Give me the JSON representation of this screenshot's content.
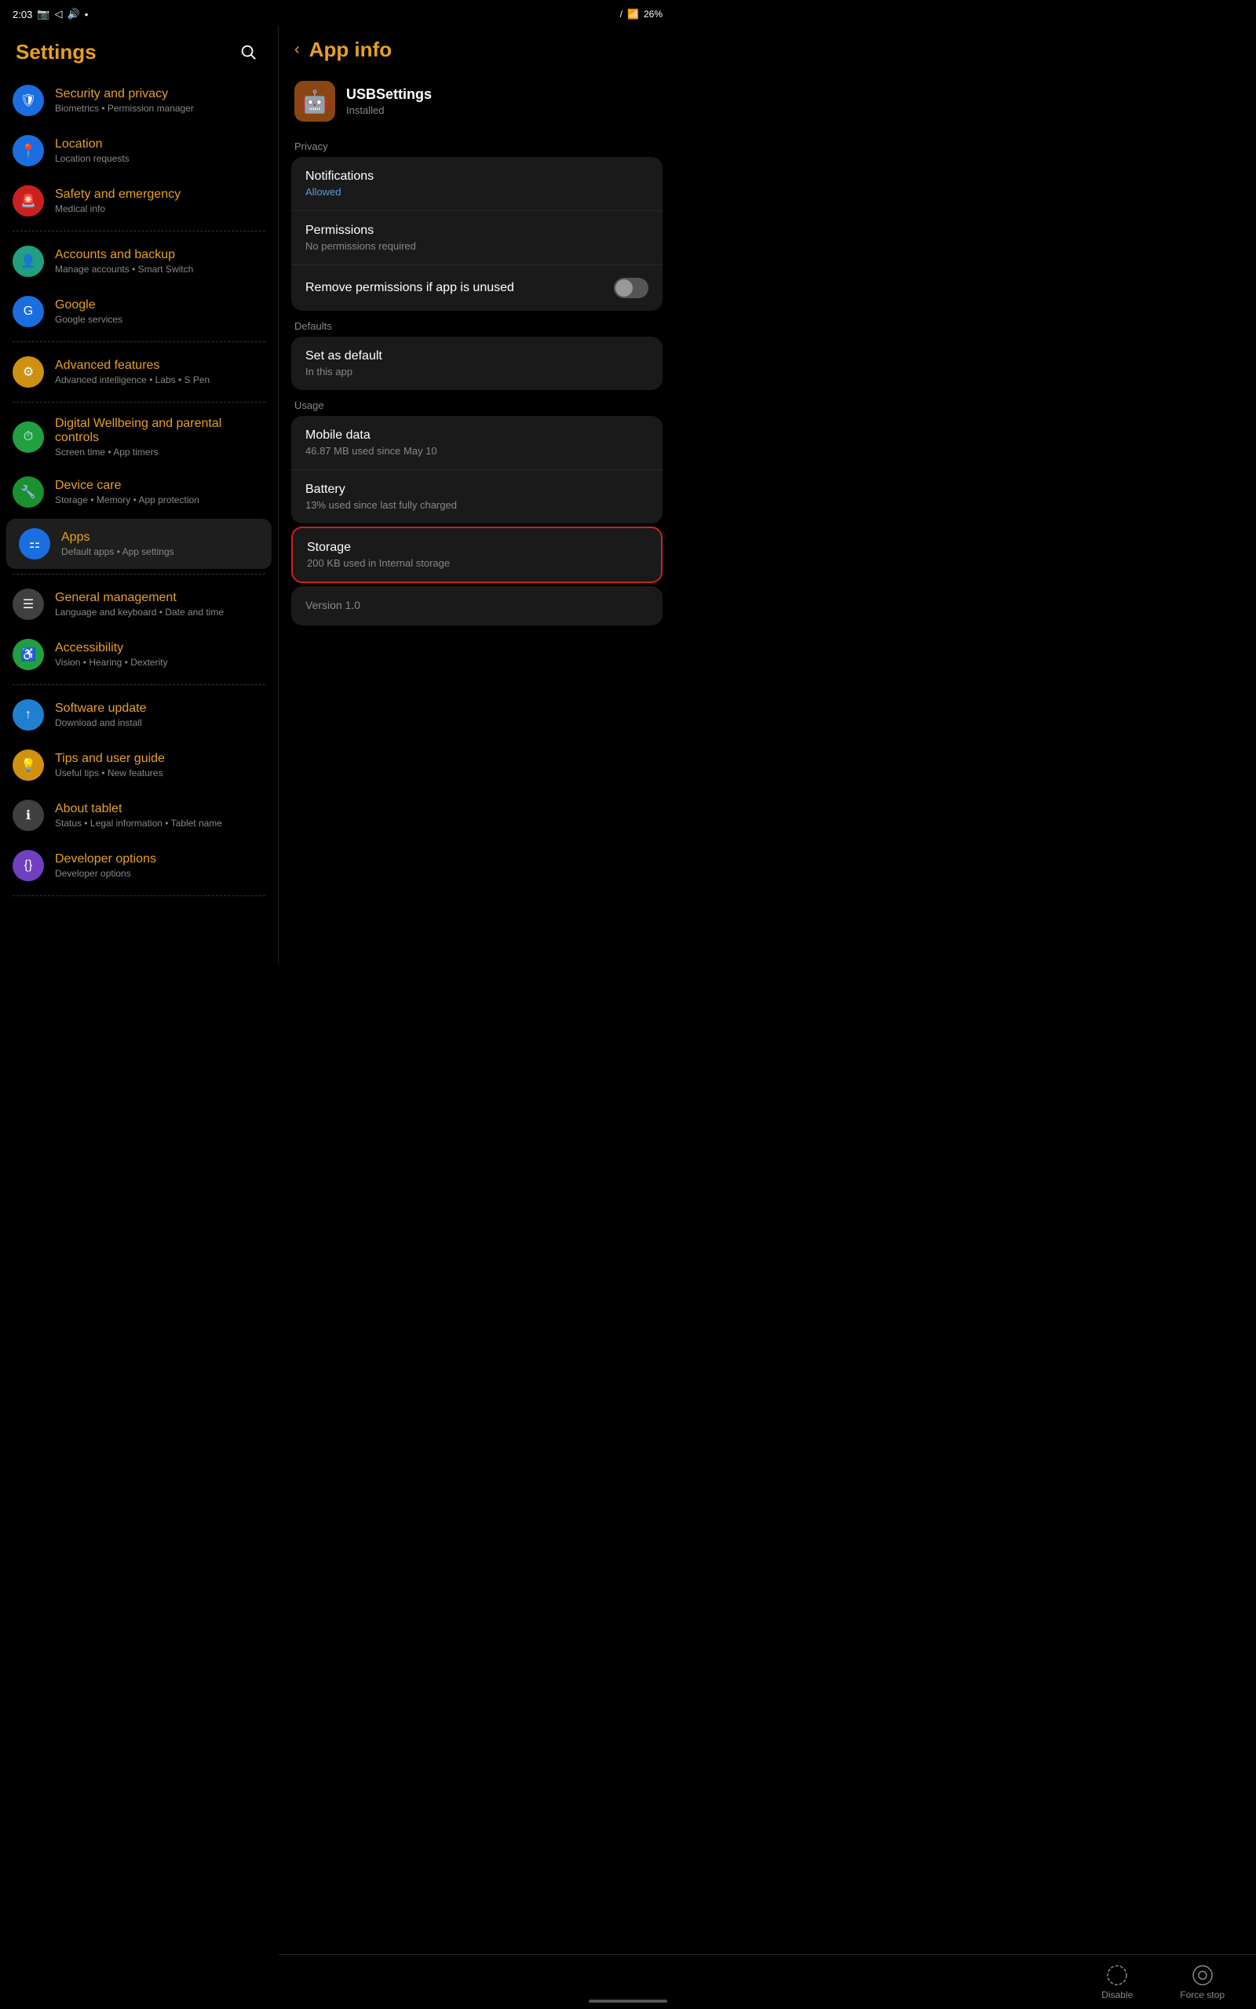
{
  "statusBar": {
    "time": "2:03",
    "battery": "26%",
    "signal": "wifi"
  },
  "settings": {
    "title": "Settings",
    "searchAriaLabel": "Search",
    "items": [
      {
        "id": "security",
        "title": "Security and privacy",
        "subtitle": "Biometrics • Permission manager",
        "iconColor": "icon-blue",
        "iconSymbol": "🛡"
      },
      {
        "id": "location",
        "title": "Location",
        "subtitle": "Location requests",
        "iconColor": "icon-blue",
        "iconSymbol": "📍"
      },
      {
        "id": "safety",
        "title": "Safety and emergency",
        "subtitle": "Medical info",
        "iconColor": "icon-red",
        "iconSymbol": "🚨"
      },
      {
        "id": "accounts",
        "title": "Accounts and backup",
        "subtitle": "Manage accounts • Smart Switch",
        "iconColor": "icon-teal",
        "iconSymbol": "👤"
      },
      {
        "id": "google",
        "title": "Google",
        "subtitle": "Google services",
        "iconColor": "icon-google-blue",
        "iconSymbol": "G"
      },
      {
        "id": "advanced",
        "title": "Advanced features",
        "subtitle": "Advanced intelligence • Labs • S Pen",
        "iconColor": "icon-yellow",
        "iconSymbol": "⚙"
      },
      {
        "id": "wellbeing",
        "title": "Digital Wellbeing and parental controls",
        "subtitle": "Screen time • App timers",
        "iconColor": "icon-green",
        "iconSymbol": "⏱"
      },
      {
        "id": "device-care",
        "title": "Device care",
        "subtitle": "Storage • Memory • App protection",
        "iconColor": "icon-green2",
        "iconSymbol": "🔧"
      },
      {
        "id": "apps",
        "title": "Apps",
        "subtitle": "Default apps • App settings",
        "iconColor": "icon-blue",
        "iconSymbol": "⚏",
        "active": true
      },
      {
        "id": "general",
        "title": "General management",
        "subtitle": "Language and keyboard • Date and time",
        "iconColor": "icon-gray",
        "iconSymbol": "☰"
      },
      {
        "id": "accessibility",
        "title": "Accessibility",
        "subtitle": "Vision • Hearing • Dexterity",
        "iconColor": "icon-green",
        "iconSymbol": "♿"
      },
      {
        "id": "software-update",
        "title": "Software update",
        "subtitle": "Download and install",
        "iconColor": "icon-light-blue",
        "iconSymbol": "↑"
      },
      {
        "id": "tips",
        "title": "Tips and user guide",
        "subtitle": "Useful tips • New features",
        "iconColor": "icon-yellow",
        "iconSymbol": "💡"
      },
      {
        "id": "about",
        "title": "About tablet",
        "subtitle": "Status • Legal information • Tablet name",
        "iconColor": "icon-gray",
        "iconSymbol": "ℹ"
      },
      {
        "id": "developer",
        "title": "Developer options",
        "subtitle": "Developer options",
        "iconColor": "icon-purple",
        "iconSymbol": "{}"
      }
    ]
  },
  "appInfo": {
    "backLabel": "‹",
    "title": "App info",
    "appIcon": "🤖",
    "appName": "USBSettings",
    "appStatus": "Installed",
    "sections": {
      "privacy": {
        "label": "Privacy",
        "notifications": {
          "title": "Notifications",
          "subtitle": "Allowed"
        },
        "permissions": {
          "title": "Permissions",
          "subtitle": "No permissions required"
        },
        "removePermissions": {
          "label": "Remove permissions if app is unused",
          "toggleOn": false
        }
      },
      "defaults": {
        "label": "Defaults",
        "setAsDefault": {
          "title": "Set as default",
          "subtitle": "In this app"
        }
      },
      "usage": {
        "label": "Usage",
        "mobileData": {
          "title": "Mobile data",
          "subtitle": "46.87 MB used since May 10"
        },
        "battery": {
          "title": "Battery",
          "subtitle": "13% used since last fully charged"
        },
        "storage": {
          "title": "Storage",
          "subtitle": "200 KB used in Internal storage",
          "highlighted": true
        }
      },
      "version": {
        "label": "Version 1.0"
      }
    }
  },
  "bottomNav": {
    "disable": {
      "label": "Disable",
      "iconType": "circle-dashed"
    },
    "forceStop": {
      "label": "Force stop",
      "iconType": "stop-circle"
    }
  }
}
